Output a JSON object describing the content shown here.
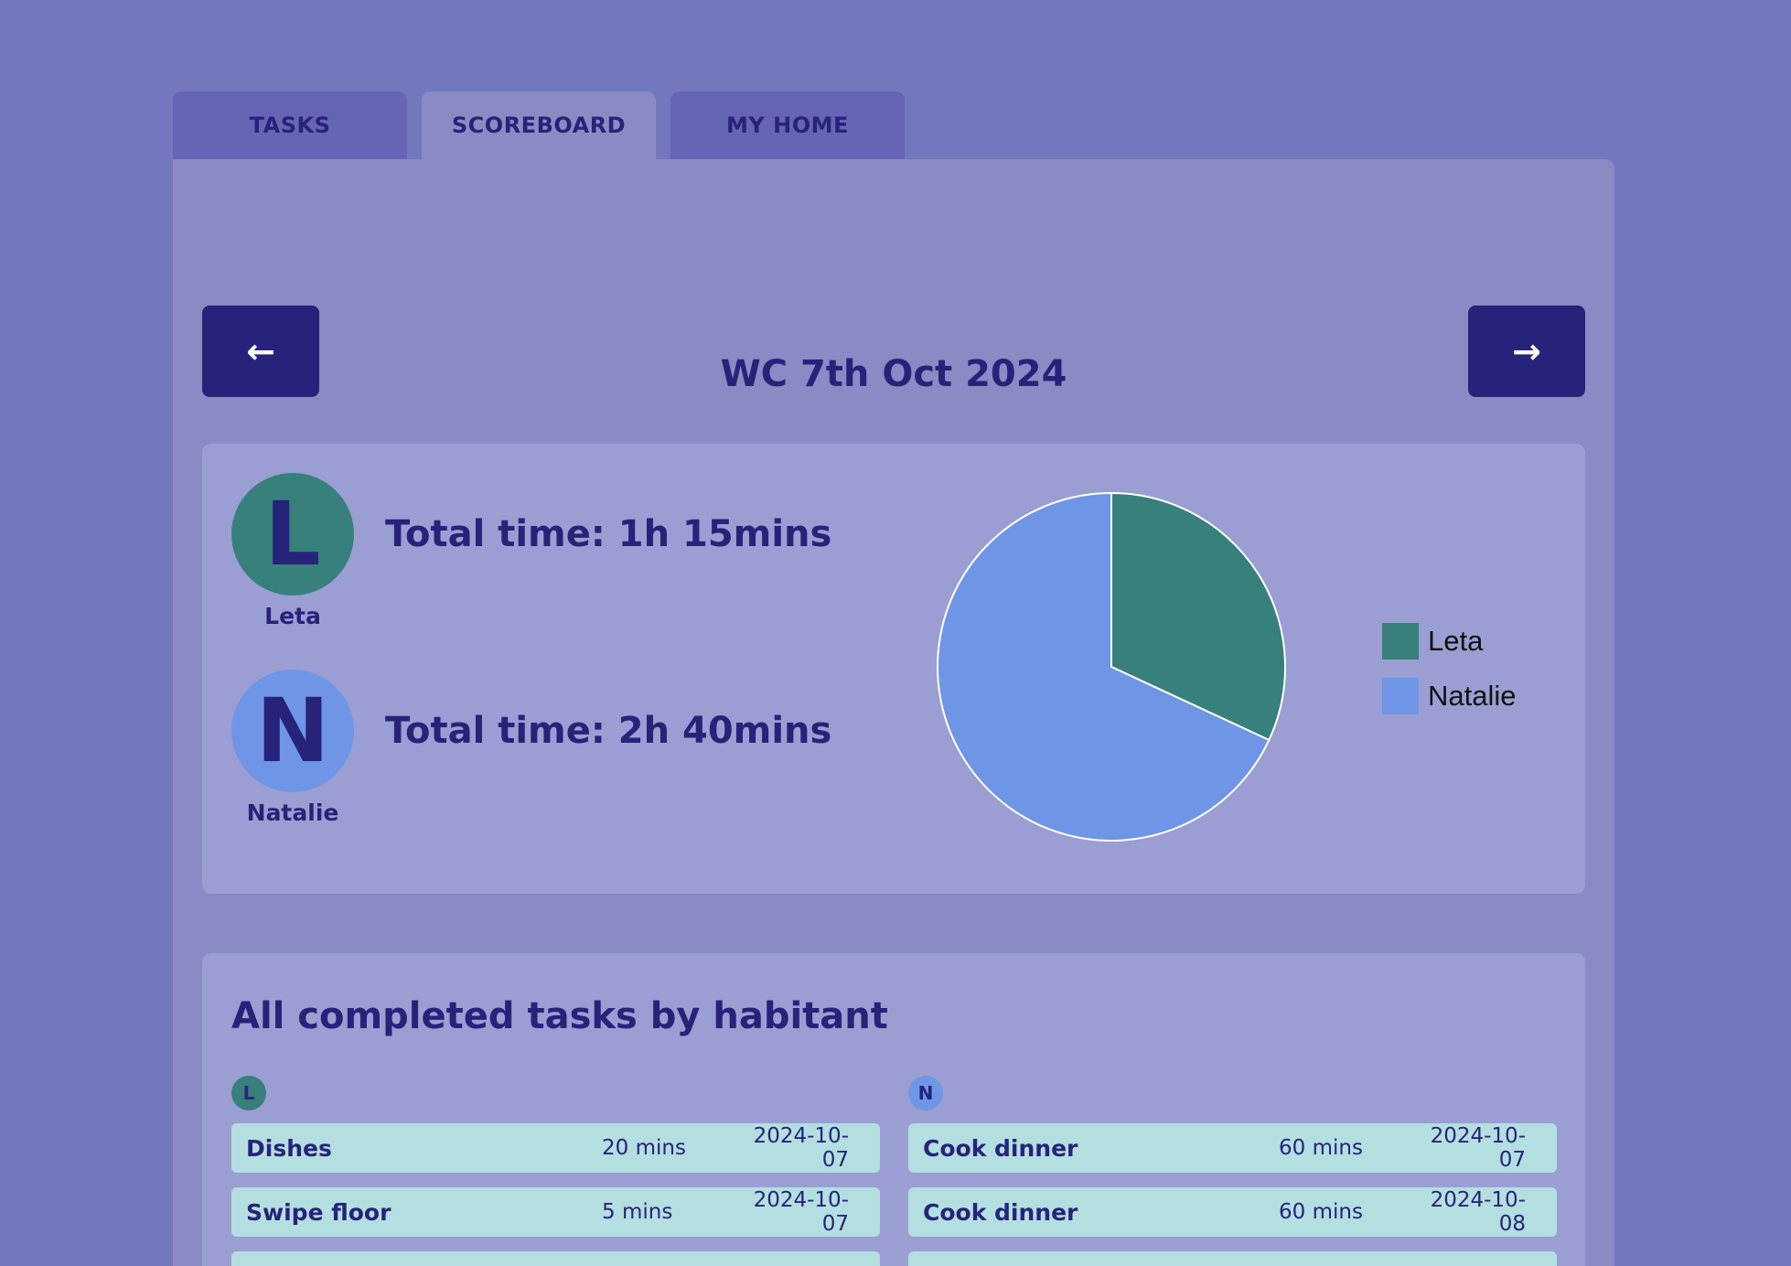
{
  "tabs": [
    {
      "label": "TASKS",
      "active": false
    },
    {
      "label": "SCOREBOARD",
      "active": true
    },
    {
      "label": "MY HOME",
      "active": false
    }
  ],
  "week": {
    "prev_label": "←",
    "next_label": "→",
    "title": "WC 7th Oct 2024"
  },
  "people": [
    {
      "initial": "L",
      "name": "Leta",
      "total_time": "Total time: 1h 15mins",
      "color": "#37807c"
    },
    {
      "initial": "N",
      "name": "Natalie",
      "total_time": "Total time: 2h 40mins",
      "color": "#6f95e6"
    }
  ],
  "chart_data": {
    "type": "pie",
    "labels": [
      "Leta",
      "Natalie"
    ],
    "values": [
      75,
      160
    ],
    "colors": [
      "#37807c",
      "#6f95e6"
    ],
    "legend_position": "right"
  },
  "tasks_section": {
    "heading": "All completed tasks by habitant",
    "columns": [
      {
        "initial": "L",
        "color": "#37807c",
        "rows": [
          {
            "name": "Dishes",
            "mins": "20 mins",
            "date": "2024-10-07"
          },
          {
            "name": "Swipe floor",
            "mins": "5 mins",
            "date": "2024-10-07"
          },
          {
            "name": "",
            "mins": "",
            "date": ""
          }
        ]
      },
      {
        "initial": "N",
        "color": "#6f95e6",
        "rows": [
          {
            "name": "Cook dinner",
            "mins": "60 mins",
            "date": "2024-10-07"
          },
          {
            "name": "Cook dinner",
            "mins": "60 mins",
            "date": "2024-10-08"
          },
          {
            "name": "",
            "mins": "",
            "date": ""
          }
        ]
      }
    ]
  }
}
